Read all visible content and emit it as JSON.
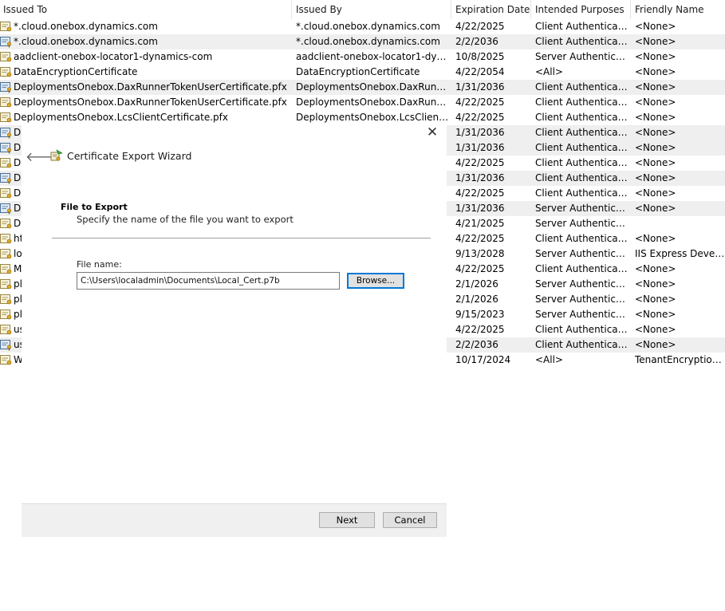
{
  "columns": [
    "Issued To",
    "Issued By",
    "Expiration Date",
    "Intended Purposes",
    "Friendly Name"
  ],
  "rows": [
    [
      "*.cloud.onebox.dynamics.com",
      "*.cloud.onebox.dynamics.com",
      "4/22/2025",
      "Client Authenticati...",
      "<None>"
    ],
    [
      "*.cloud.onebox.dynamics.com",
      "*.cloud.onebox.dynamics.com",
      "2/2/2036",
      "Client Authenticati...",
      "<None>"
    ],
    [
      "aadclient-onebox-locator1-dynamics-com",
      "aadclient-onebox-locator1-dyna...",
      "10/8/2025",
      "Server Authenticati...",
      "<None>"
    ],
    [
      "DataEncryptionCertificate",
      "DataEncryptionCertificate",
      "4/22/2054",
      "<All>",
      "<None>"
    ],
    [
      "DeploymentsOnebox.DaxRunnerTokenUserCertificate.pfx",
      "DeploymentsOnebox.DaxRunnerT...",
      "1/31/2036",
      "Client Authenticati...",
      "<None>"
    ],
    [
      "DeploymentsOnebox.DaxRunnerTokenUserCertificate.pfx",
      "DeploymentsOnebox.DaxRunnerT...",
      "4/22/2025",
      "Client Authenticati...",
      "<None>"
    ],
    [
      "DeploymentsOnebox.LcsClientCertificate.pfx",
      "DeploymentsOnebox.LcsClientCe...",
      "4/22/2025",
      "Client Authenticati...",
      "<None>"
    ],
    [
      "D",
      "",
      "1/31/2036",
      "Client Authenticati...",
      "<None>"
    ],
    [
      "D",
      "",
      "1/31/2036",
      "Client Authenticati...",
      "<None>"
    ],
    [
      "D",
      "",
      "4/22/2025",
      "Client Authenticati...",
      "<None>"
    ],
    [
      "D",
      "",
      "1/31/2036",
      "Client Authenticati...",
      "<None>"
    ],
    [
      "D",
      "",
      "4/22/2025",
      "Client Authenticati...",
      "<None>"
    ],
    [
      "D",
      "",
      "1/31/2036",
      "Server Authenticati...",
      "<None>"
    ],
    [
      "D",
      "",
      "4/21/2025",
      "Server Authenticati...",
      ""
    ],
    [
      "ht",
      "",
      "4/22/2025",
      "Client Authenticati...",
      "<None>"
    ],
    [
      "lo",
      "",
      "9/13/2028",
      "Server Authenticati...",
      "IIS Express Develop..."
    ],
    [
      "M",
      "",
      "4/22/2025",
      "Client Authenticati...",
      "<None>"
    ],
    [
      "pl",
      "",
      "2/1/2026",
      "Server Authenticati...",
      "<None>"
    ],
    [
      "pl",
      "",
      "2/1/2026",
      "Server Authenticati...",
      "<None>"
    ],
    [
      "pl",
      "",
      "9/15/2023",
      "Server Authenticati...",
      "<None>"
    ],
    [
      "us",
      "",
      "4/22/2025",
      "Client Authenticati...",
      "<None>"
    ],
    [
      "us",
      "",
      "2/2/2036",
      "Client Authenticati...",
      "<None>"
    ],
    [
      "W",
      "",
      "10/17/2024",
      "<All>",
      "TenantEncryptionC..."
    ]
  ],
  "icon_types": [
    "cert",
    "key",
    "cert",
    "cert",
    "key",
    "cert",
    "cert",
    "key",
    "key",
    "cert",
    "key",
    "cert",
    "key",
    "cert",
    "cert",
    "cert",
    "cert",
    "cert",
    "cert",
    "cert",
    "cert",
    "key",
    "cert"
  ],
  "wizard": {
    "close_glyph": "✕",
    "back_glyph": "🡐",
    "title": "Certificate Export Wizard",
    "section_title": "File to Export",
    "section_desc": "Specify the name of the file you want to export",
    "file_label": "File name:",
    "file_value": "C:\\Users\\localadmin\\Documents\\Local_Cert.p7b",
    "browse_label": "Browse...",
    "next_label": "Next",
    "cancel_label": "Cancel"
  },
  "colors": {
    "accent": "#0078d7",
    "row_alt": "#efefef",
    "footer": "#f0f0f0"
  }
}
